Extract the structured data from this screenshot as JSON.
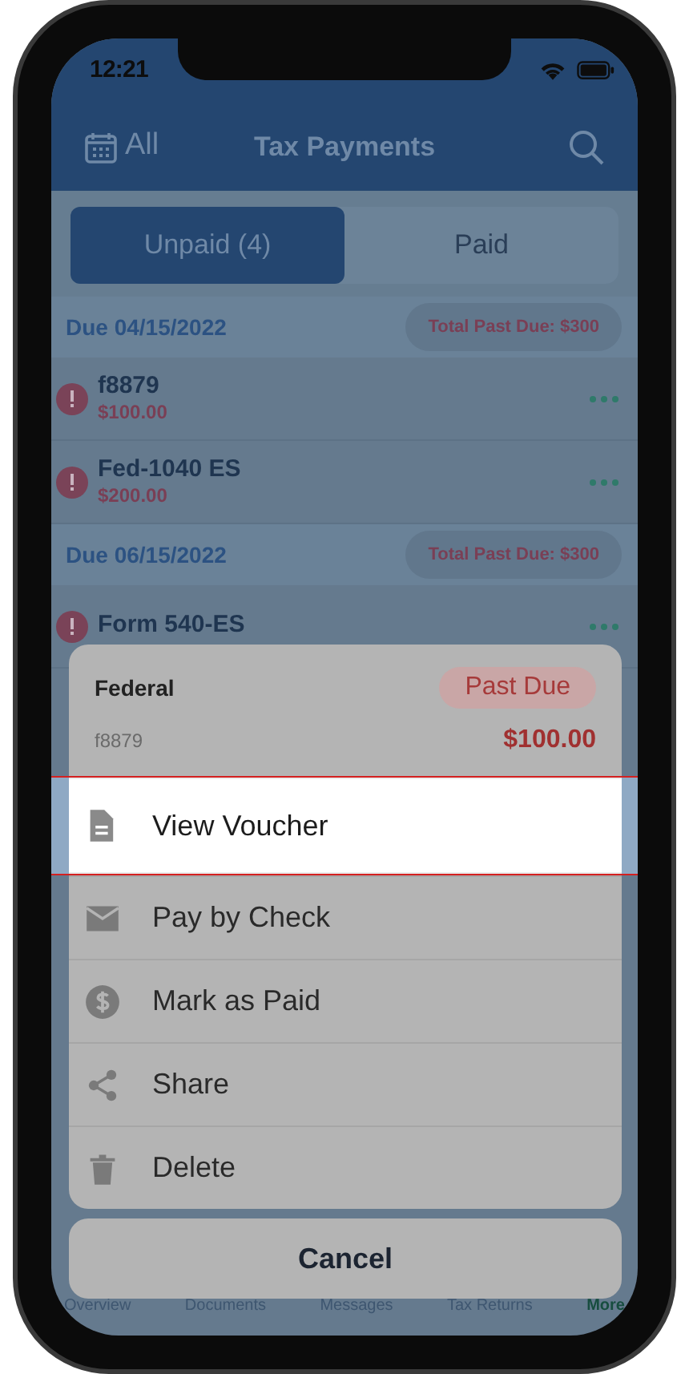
{
  "status_bar": {
    "time": "12:21"
  },
  "nav": {
    "filter": "All",
    "title": "Tax Payments"
  },
  "segments": [
    {
      "label": "Unpaid (4)",
      "selected": true
    },
    {
      "label": "Paid",
      "selected": false
    }
  ],
  "sections": [
    {
      "due": "Due 04/15/2022",
      "badge": "Total Past Due: $300",
      "payments": [
        {
          "name": "f8879",
          "amount": "$100.00"
        },
        {
          "name": "Fed-1040 ES",
          "amount": "$200.00"
        }
      ]
    },
    {
      "due": "Due 06/15/2022",
      "badge": "Total Past Due: $300",
      "payments": [
        {
          "name": "Form 540-ES"
        }
      ]
    }
  ],
  "action_sheet": {
    "title": "Federal",
    "status": "Past Due",
    "form": "f8879",
    "amount": "$100.00",
    "actions": [
      {
        "kind": "document",
        "label": "View Voucher",
        "selected": true
      },
      {
        "kind": "envelope",
        "label": "Pay by Check",
        "selected": false
      },
      {
        "kind": "dollar",
        "label": "Mark as Paid",
        "selected": false
      },
      {
        "kind": "share",
        "label": "Share",
        "selected": false
      },
      {
        "kind": "trash",
        "label": "Delete",
        "selected": false
      }
    ],
    "cancel": "Cancel"
  },
  "tab_bar": [
    {
      "label": "Overview",
      "selected": false
    },
    {
      "label": "Documents",
      "selected": false
    },
    {
      "label": "Messages",
      "selected": false
    },
    {
      "label": "Tax Returns",
      "selected": false
    },
    {
      "label": "More",
      "selected": true
    }
  ]
}
